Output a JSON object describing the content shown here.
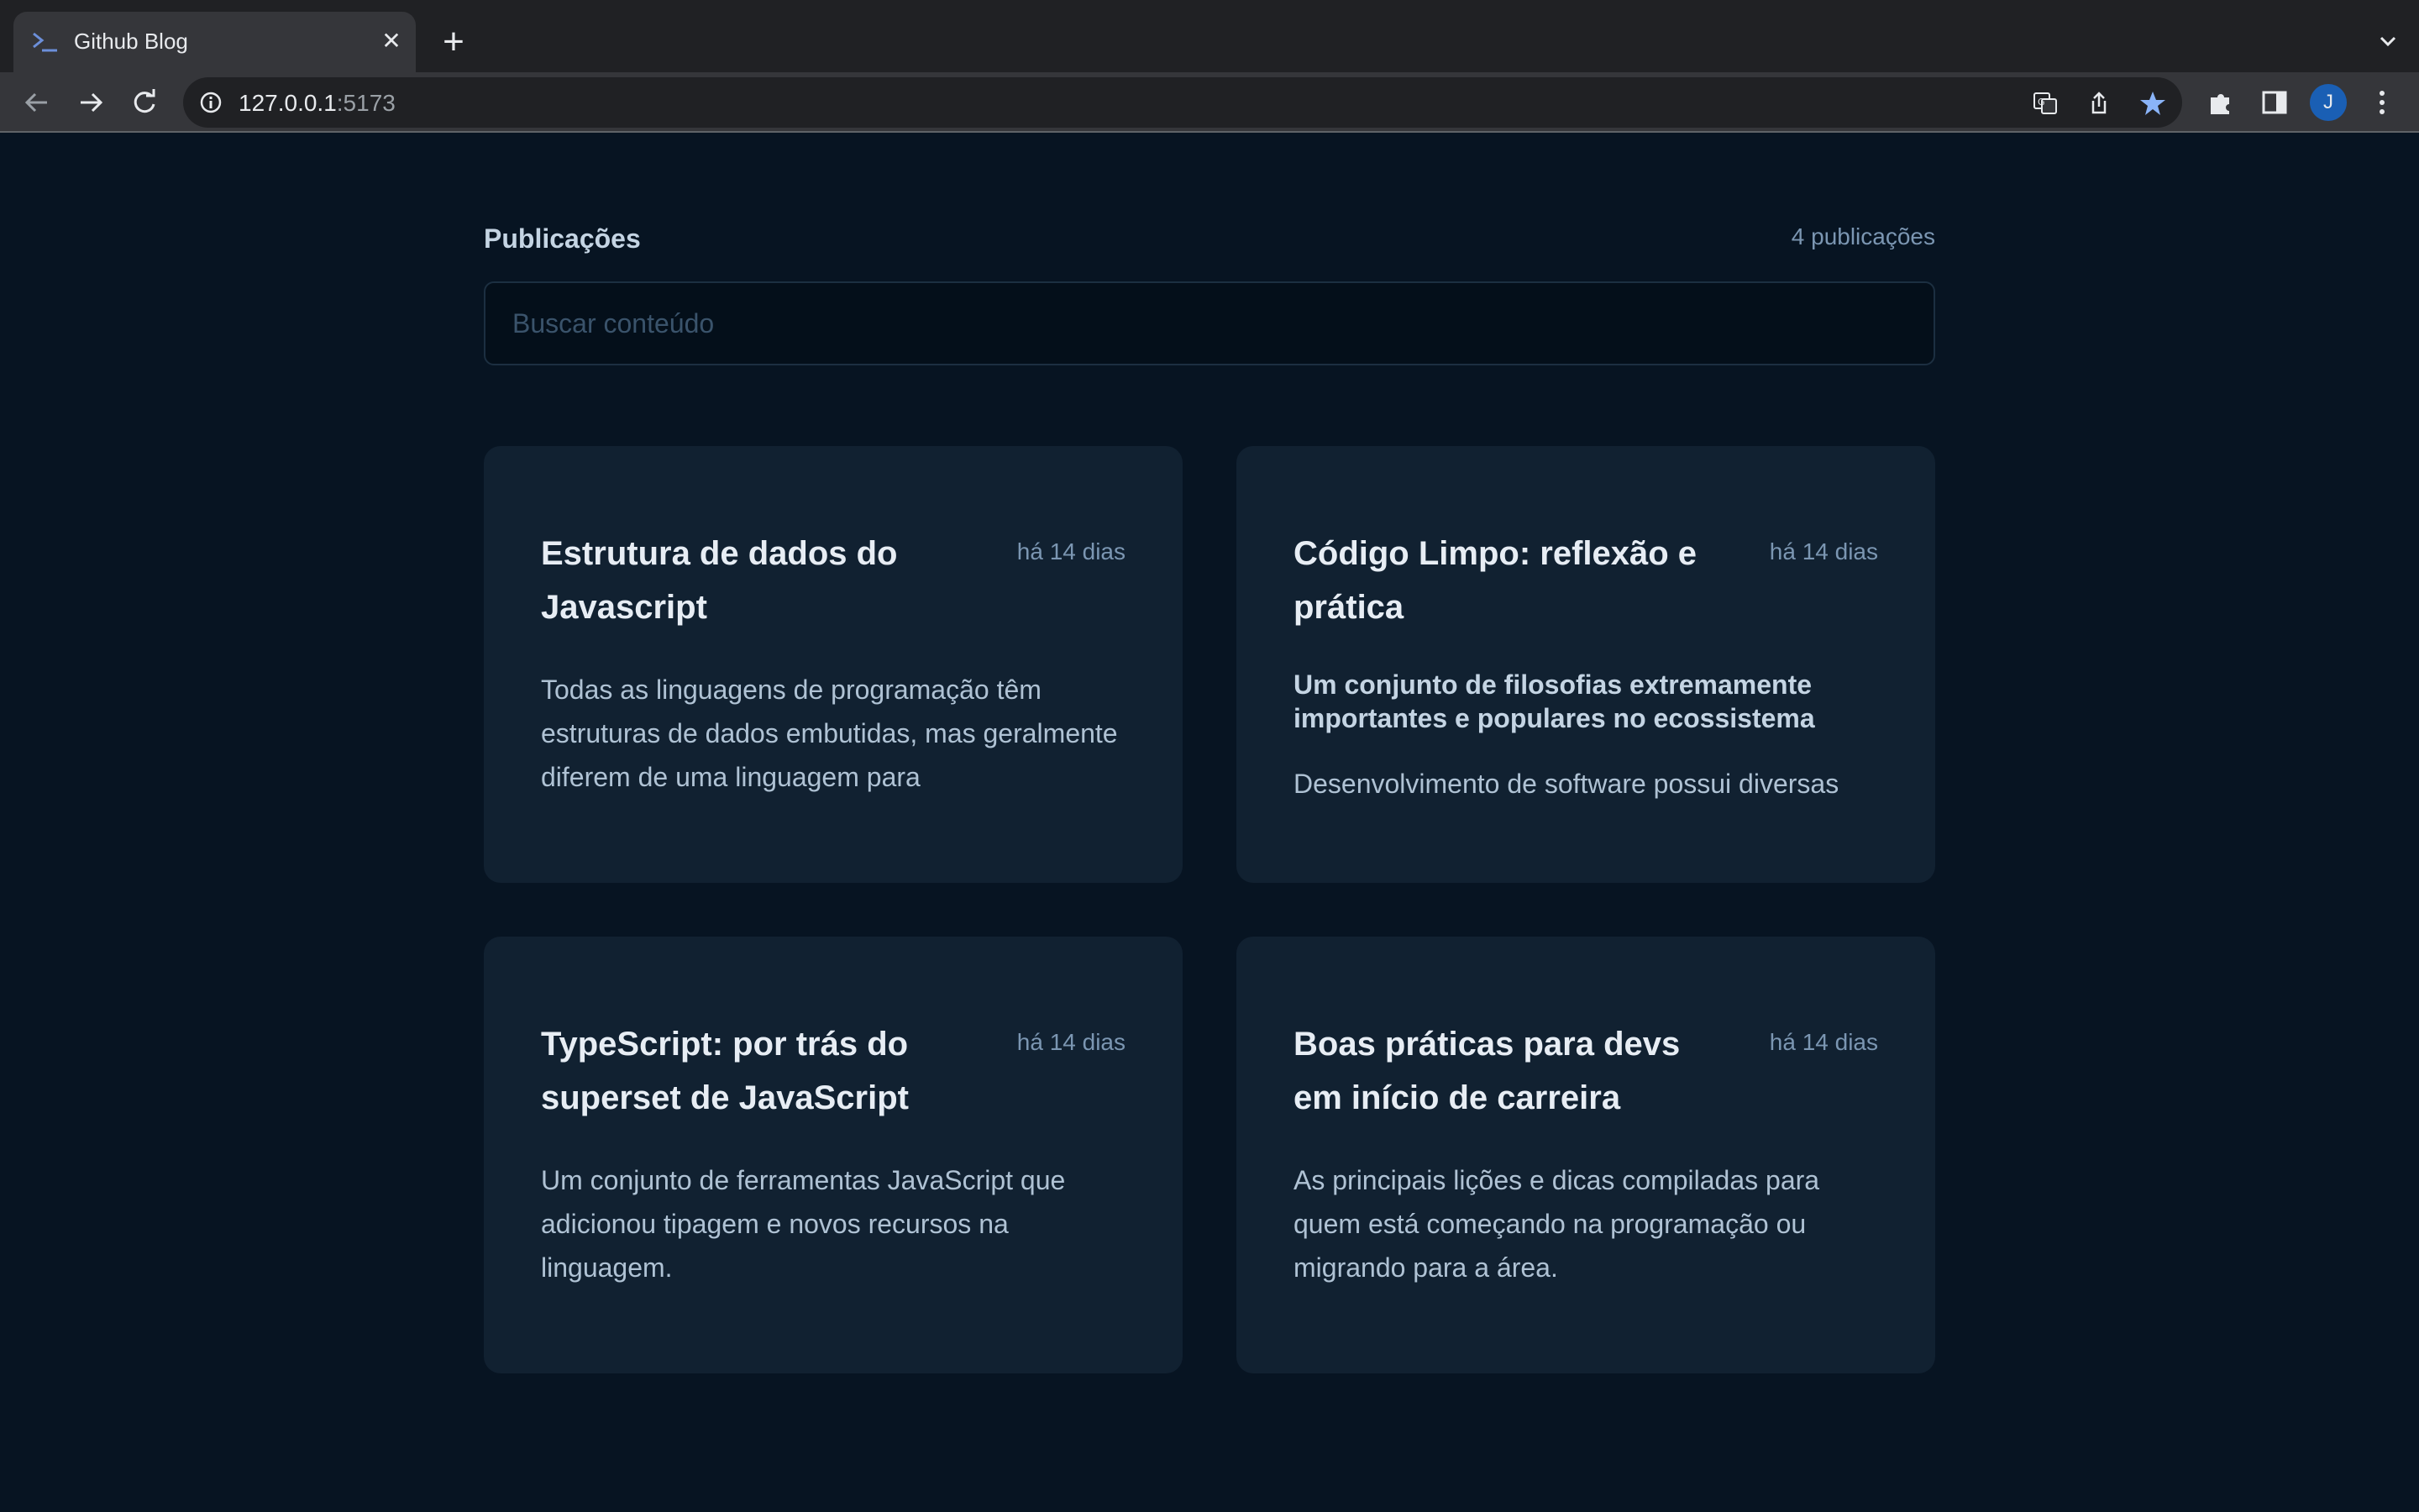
{
  "browser": {
    "tab_title": "Github Blog",
    "url_host": "127.0.0.1",
    "url_port": ":5173"
  },
  "profile": {
    "initial": "J"
  },
  "posts_section": {
    "title": "Publicações",
    "count_label": "4 publicações",
    "search_placeholder": "Buscar conteúdo"
  },
  "posts": [
    {
      "title": "Estrutura de dados do Javascript",
      "date": "há 14 dias",
      "excerpt": "Todas as linguagens de programação têm estruturas de dados embutidas, mas geralmente diferem de uma linguagem para"
    },
    {
      "title": "Código Limpo: reflexão e prática",
      "date": "há 14 dias",
      "subtitle": "Um conjunto de filosofias extremamente importantes e populares no ecossistema",
      "excerpt": "Desenvolvimento de software possui diversas"
    },
    {
      "title": "TypeScript: por trás do superset de JavaScript",
      "date": "há 14 dias",
      "excerpt": "Um conjunto de ferramentas JavaScript que adicionou tipagem e novos recursos na linguagem."
    },
    {
      "title": "Boas práticas para devs em início de carreira",
      "date": "há 14 dias",
      "excerpt": "As principais lições e dicas compiladas para quem está começando na programação ou migrando para a área."
    }
  ],
  "colors": {
    "page_background": "#071422",
    "card_background": "#112131",
    "bookmark_star": "#8ab4f8",
    "avatar": "#1a5fb4"
  }
}
